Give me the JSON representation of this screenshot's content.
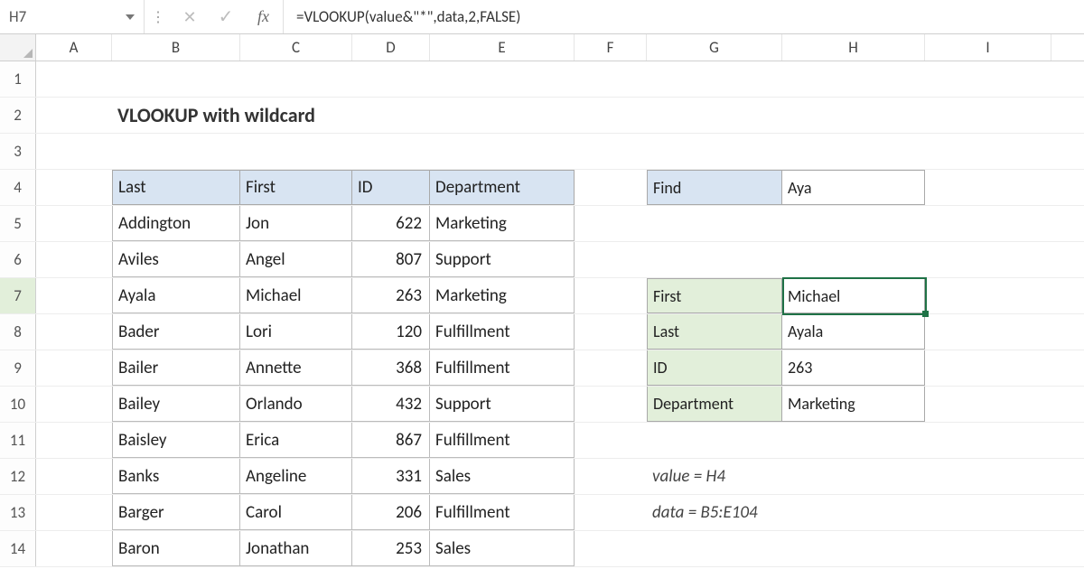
{
  "name_box": "H7",
  "formula": "=VLOOKUP(value&\"*\",data,2,FALSE)",
  "fx_label": "fx",
  "columns": [
    "A",
    "B",
    "C",
    "D",
    "E",
    "F",
    "G",
    "H",
    "I"
  ],
  "row_numbers": [
    "1",
    "2",
    "3",
    "4",
    "5",
    "6",
    "7",
    "8",
    "9",
    "10",
    "11",
    "12",
    "13",
    "14"
  ],
  "title": "VLOOKUP with wildcard",
  "table_headers": {
    "last": "Last",
    "first": "First",
    "id": "ID",
    "dept": "Department"
  },
  "table_rows": [
    {
      "last": "Addington",
      "first": "Jon",
      "id": "622",
      "dept": "Marketing"
    },
    {
      "last": "Aviles",
      "first": "Angel",
      "id": "807",
      "dept": "Support"
    },
    {
      "last": "Ayala",
      "first": "Michael",
      "id": "263",
      "dept": "Marketing"
    },
    {
      "last": "Bader",
      "first": "Lori",
      "id": "120",
      "dept": "Fulfillment"
    },
    {
      "last": "Bailer",
      "first": "Annette",
      "id": "368",
      "dept": "Fulfillment"
    },
    {
      "last": "Bailey",
      "first": "Orlando",
      "id": "432",
      "dept": "Support"
    },
    {
      "last": "Baisley",
      "first": "Erica",
      "id": "867",
      "dept": "Fulfillment"
    },
    {
      "last": "Banks",
      "first": "Angeline",
      "id": "331",
      "dept": "Sales"
    },
    {
      "last": "Barger",
      "first": "Carol",
      "id": "206",
      "dept": "Fulfillment"
    },
    {
      "last": "Baron",
      "first": "Jonathan",
      "id": "253",
      "dept": "Sales"
    }
  ],
  "find": {
    "label": "Find",
    "value": "Aya"
  },
  "results": [
    {
      "label": "First",
      "value": "Michael"
    },
    {
      "label": "Last",
      "value": "Ayala"
    },
    {
      "label": "ID",
      "value": "263"
    },
    {
      "label": "Department",
      "value": "Marketing"
    }
  ],
  "notes": {
    "value": "value = H4",
    "data": "data = B5:E104"
  },
  "chart_data": {
    "type": "table",
    "columns": [
      "Last",
      "First",
      "ID",
      "Department"
    ],
    "rows": [
      [
        "Addington",
        "Jon",
        622,
        "Marketing"
      ],
      [
        "Aviles",
        "Angel",
        807,
        "Support"
      ],
      [
        "Ayala",
        "Michael",
        263,
        "Marketing"
      ],
      [
        "Bader",
        "Lori",
        120,
        "Fulfillment"
      ],
      [
        "Bailer",
        "Annette",
        368,
        "Fulfillment"
      ],
      [
        "Bailey",
        "Orlando",
        432,
        "Support"
      ],
      [
        "Baisley",
        "Erica",
        867,
        "Fulfillment"
      ],
      [
        "Banks",
        "Angeline",
        331,
        "Sales"
      ],
      [
        "Barger",
        "Carol",
        206,
        "Fulfillment"
      ],
      [
        "Baron",
        "Jonathan",
        253,
        "Sales"
      ]
    ]
  }
}
